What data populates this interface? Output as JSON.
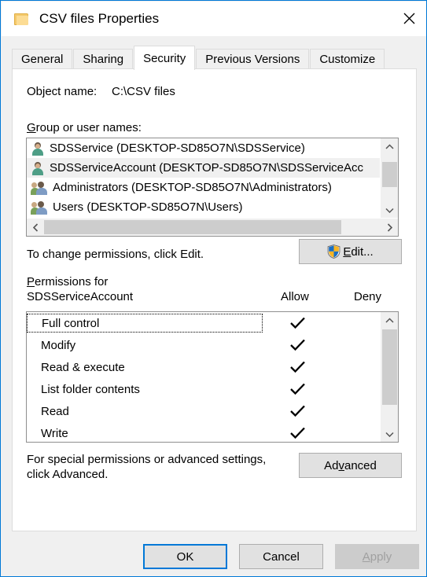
{
  "window": {
    "title": "CSV files Properties",
    "icon": "folder-icon",
    "close_label": "✕"
  },
  "tabs": [
    {
      "label": "General",
      "active": false
    },
    {
      "label": "Sharing",
      "active": false
    },
    {
      "label": "Security",
      "active": true
    },
    {
      "label": "Previous Versions",
      "active": false
    },
    {
      "label": "Customize",
      "active": false
    }
  ],
  "security": {
    "object_name_label": "Object name:",
    "object_name_value": "C:\\CSV files",
    "group_or_user_names_label": "Group or user names:",
    "group_label_accel": "G",
    "group_label_rest": "roup or user names:",
    "users": [
      {
        "name": "SDSService (DESKTOP-SD85O7N\\SDSService)",
        "icon": "person-icon",
        "selected": false
      },
      {
        "name": "SDSServiceAccount (DESKTOP-SD85O7N\\SDSServiceAcc",
        "icon": "person-icon",
        "selected": true
      },
      {
        "name": "Administrators (DESKTOP-SD85O7N\\Administrators)",
        "icon": "group-icon",
        "selected": false
      },
      {
        "name": "Users (DESKTOP-SD85O7N\\Users)",
        "icon": "group-icon",
        "selected": false
      }
    ],
    "change_permissions_text": "To change permissions, click Edit.",
    "edit_button": {
      "label": "Edit...",
      "accel": "E",
      "rest": "dit...",
      "icon": "uac-shield-icon"
    },
    "permissions_for_line1_accel": "P",
    "permissions_for_line1_rest": "ermissions for",
    "permissions_for_line1": "Permissions for",
    "permissions_for_line2": "SDSServiceAccount",
    "allow_header": "Allow",
    "deny_header": "Deny",
    "permissions": [
      {
        "name": "Full control",
        "allow": true,
        "deny": false,
        "focused": true
      },
      {
        "name": "Modify",
        "allow": true,
        "deny": false,
        "focused": false
      },
      {
        "name": "Read & execute",
        "allow": true,
        "deny": false,
        "focused": false
      },
      {
        "name": "List folder contents",
        "allow": true,
        "deny": false,
        "focused": false
      },
      {
        "name": "Read",
        "allow": true,
        "deny": false,
        "focused": false
      },
      {
        "name": "Write",
        "allow": true,
        "deny": false,
        "focused": false
      }
    ],
    "special_permissions_line1": "For special permissions or advanced settings,",
    "special_permissions_line2": "click Advanced.",
    "advanced_button": {
      "label": "Advanced",
      "pre": "Ad",
      "accel": "v",
      "rest": "anced"
    }
  },
  "footer": {
    "ok_label": "OK",
    "cancel_label": "Cancel",
    "apply_label": "Apply",
    "apply_accel": "A",
    "apply_rest": "pply",
    "apply_disabled": true
  },
  "colors": {
    "accent": "#0078d7",
    "dialog_bg": "#f0f0f0",
    "panel_bg": "#ffffff",
    "button_bg": "#e1e1e1",
    "disabled_text": "#a0a0a0",
    "selection_bg": "#f0f0f0",
    "scrollbar_thumb": "#cdcdcd"
  }
}
